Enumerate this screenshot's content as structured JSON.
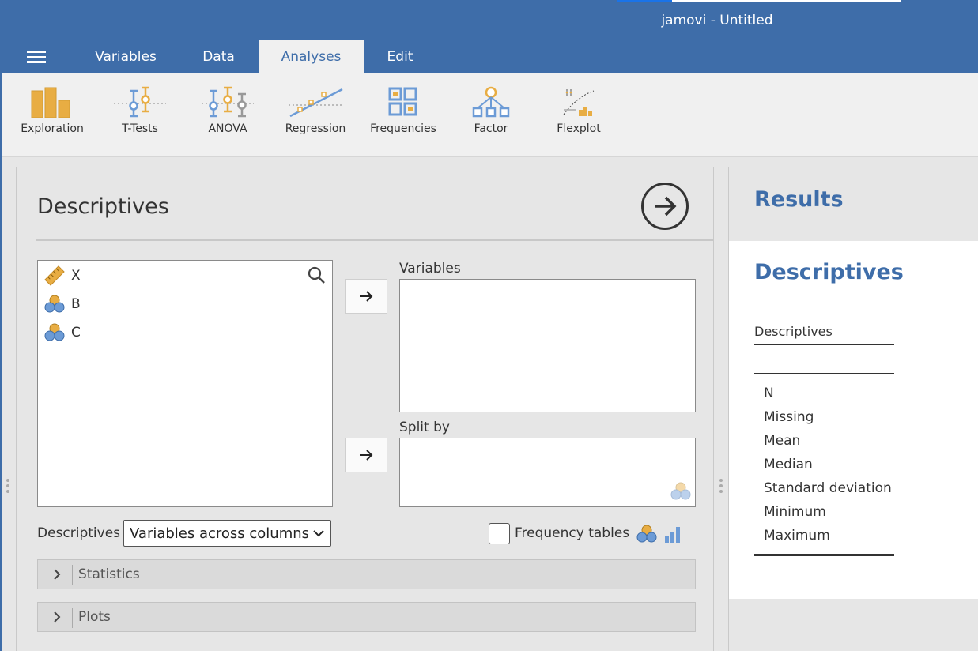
{
  "window": {
    "title": "jamovi - Untitled"
  },
  "tabs": [
    {
      "label": "Variables"
    },
    {
      "label": "Data"
    },
    {
      "label": "Analyses"
    },
    {
      "label": "Edit"
    }
  ],
  "active_tab": "Analyses",
  "ribbon": [
    {
      "label": "Exploration",
      "icon": "exploration-icon"
    },
    {
      "label": "T-Tests",
      "icon": "t-tests-icon"
    },
    {
      "label": "ANOVA",
      "icon": "anova-icon"
    },
    {
      "label": "Regression",
      "icon": "regression-icon"
    },
    {
      "label": "Frequencies",
      "icon": "frequencies-icon"
    },
    {
      "label": "Factor",
      "icon": "factor-icon"
    },
    {
      "label": "Flexplot",
      "icon": "flexplot-icon"
    }
  ],
  "options": {
    "title": "Descriptives",
    "variables_list": [
      {
        "name": "X",
        "type": "continuous"
      },
      {
        "name": "B",
        "type": "nominal"
      },
      {
        "name": "C",
        "type": "nominal"
      }
    ],
    "variables_label": "Variables",
    "split_by_label": "Split by",
    "descriptives_label": "Descriptives",
    "descriptives_select_value": "Variables across columns",
    "frequency_tables_label": "Frequency tables",
    "frequency_tables_checked": false,
    "sections": [
      {
        "label": "Statistics"
      },
      {
        "label": "Plots"
      }
    ]
  },
  "results": {
    "title": "Results",
    "analysis_title": "Descriptives",
    "table_title": "Descriptives",
    "rows": [
      "N",
      "Missing",
      "Mean",
      "Median",
      "Standard deviation",
      "Minimum",
      "Maximum"
    ]
  },
  "colors": {
    "brand_blue": "#3e6da9",
    "accent_orange": "#e8ad43",
    "icon_blue": "#6c9bd6"
  }
}
